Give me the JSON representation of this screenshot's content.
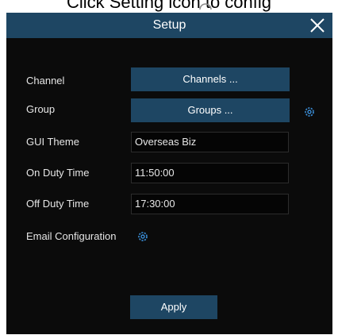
{
  "instruction": {
    "text": "Click Setting icon   to config"
  },
  "dialog": {
    "title": "Setup",
    "rows": {
      "channel": {
        "label": "Channel",
        "button": "Channels ..."
      },
      "group": {
        "label": "Group",
        "button": "Groups ..."
      },
      "gui_theme": {
        "label": "GUI Theme",
        "value": "Overseas Biz"
      },
      "on_duty": {
        "label": "On Duty Time",
        "value": "11:50:00"
      },
      "off_duty": {
        "label": "Off Duty Time",
        "value": "17:30:00"
      },
      "email": {
        "label": "Email Configuration"
      }
    },
    "apply_label": "Apply"
  },
  "colors": {
    "titlebar": "#1e4663",
    "panel": "#0b0b0b",
    "gear": "#3b8fd9",
    "text": "#e6e6e6"
  },
  "icons": {
    "close": "close-icon",
    "settings": "gear-icon"
  }
}
